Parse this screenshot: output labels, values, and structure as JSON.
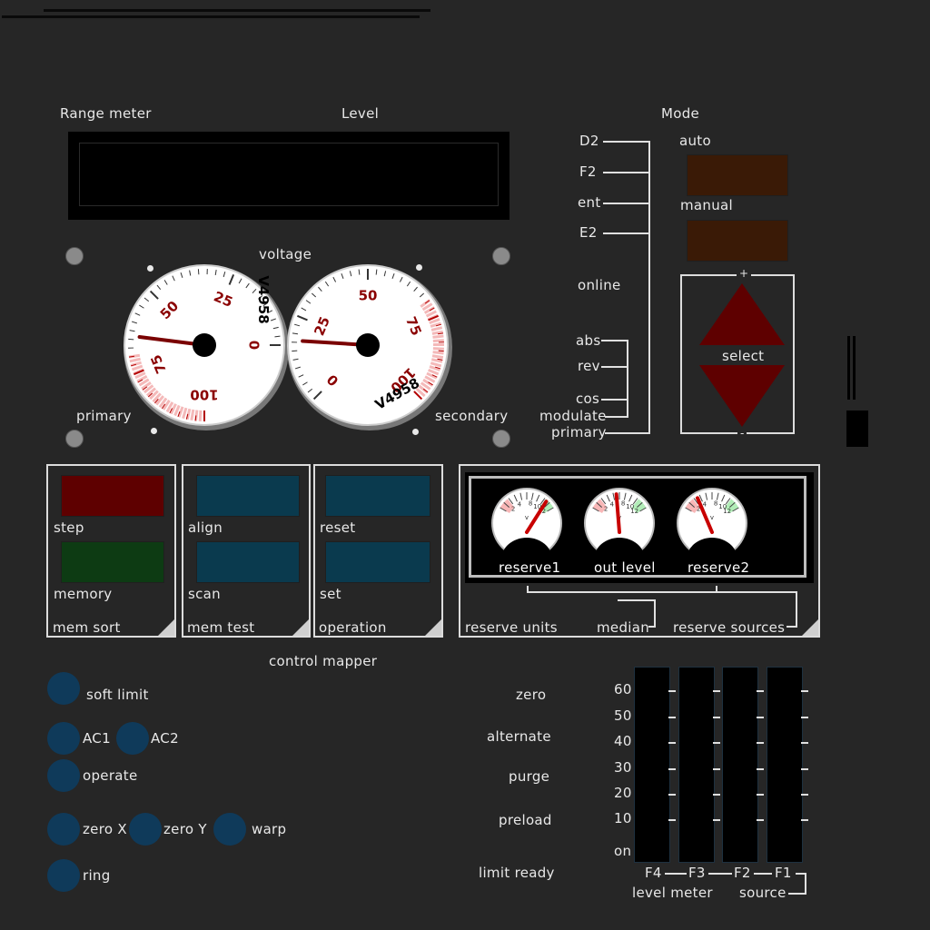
{
  "labels": {
    "range_meter": "Range meter",
    "level": "Level",
    "mode": "Mode",
    "voltage": "voltage",
    "primary_left": "primary",
    "secondary": "secondary"
  },
  "mode_inputs": [
    "D2",
    "F2",
    "ent",
    "E2"
  ],
  "online": "online",
  "sub_inputs": [
    "abs",
    "rev",
    "cos",
    "modulate"
  ],
  "primary_out": "primary",
  "mode_buttons": {
    "auto": "auto",
    "manual": "manual"
  },
  "select": {
    "label": "select",
    "plus": "+",
    "minus": "-"
  },
  "gauge_left": {
    "ticks": [
      "0",
      "25",
      "50",
      "75",
      "100"
    ],
    "model": "V4958",
    "value": 64
  },
  "gauge_right": {
    "ticks": [
      "0",
      "25",
      "50",
      "75",
      "100"
    ],
    "model": "V4958",
    "value": 18
  },
  "panels": {
    "mem_sort": {
      "title": "mem sort",
      "btn1": "step",
      "btn2": "memory"
    },
    "mem_test": {
      "title": "mem test",
      "btn1": "align",
      "btn2": "scan"
    },
    "operation": {
      "title": "operation",
      "btn1": "reset",
      "btn2": "set"
    }
  },
  "reserve": {
    "gauges": [
      "reserve1",
      "out level",
      "reserve2"
    ],
    "scale": [
      "2",
      "4",
      "8",
      "10",
      "12"
    ],
    "unit": "v",
    "units_label": "reserve units",
    "median_label": "median",
    "sources_label": "reserve sources"
  },
  "control_mapper": {
    "title": "control mapper",
    "soft_limit": "soft limit",
    "ac1": "AC1",
    "ac2": "AC2",
    "operate": "operate",
    "zero_x": "zero X",
    "zero_y": "zero Y",
    "warp": "warp",
    "ring": "ring"
  },
  "status_labels": [
    "zero",
    "alternate",
    "purge",
    "preload",
    "limit ready"
  ],
  "level_meter": {
    "scale": [
      "60",
      "50",
      "40",
      "30",
      "20",
      "10",
      "on"
    ],
    "channels": [
      "F4",
      "F3",
      "F2",
      "F1"
    ],
    "label": "level meter",
    "source": "source"
  },
  "colors": {
    "step": "#5e0000",
    "memory": "#0d3b13",
    "teal": "#0a3a4e",
    "mode_btn": "#3a1a06",
    "select_arrow": "#5e0000",
    "round_btn": "#0f3a5a"
  }
}
